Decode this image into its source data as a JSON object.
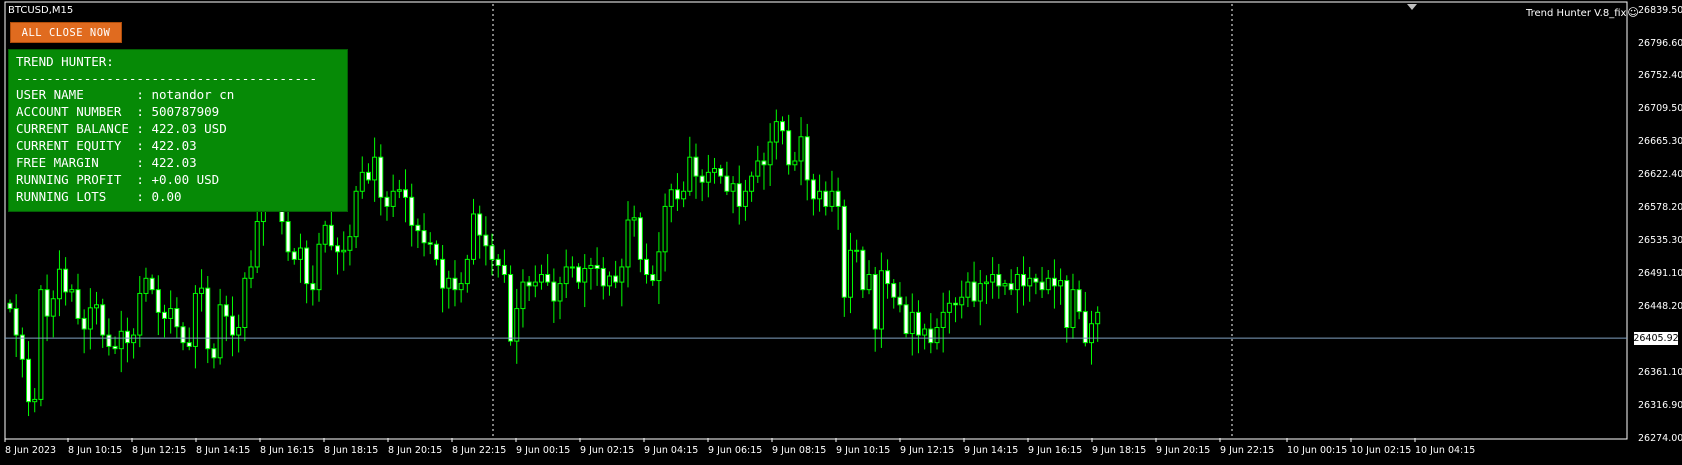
{
  "window": {
    "symbol_label": "BTCUSD,M15",
    "indicator_label": "Trend Hunter V.8_fix",
    "indicator_icon": "smiley-icon"
  },
  "panel": {
    "close_button_label": "ALL CLOSE NOW",
    "title": "TREND HUNTER:",
    "separator": "----------------------------------------",
    "rows": [
      "USER NAME       : notandor cn",
      "ACCOUNT NUMBER  : 500787909",
      "CURRENT BALANCE : 422.03 USD",
      "CURRENT EQUITY  : 422.03",
      "FREE MARGIN     : 422.03",
      "RUNNING PROFIT  : +0.00 USD",
      "RUNNING LOTS    : 0.00"
    ],
    "button_color": "#e06b1f",
    "panel_color": "#068a06"
  },
  "price_axis": {
    "ticks": [
      "26839.50",
      "26796.60",
      "26752.40",
      "26709.50",
      "26665.30",
      "26622.40",
      "26578.20",
      "26535.30",
      "26491.10",
      "26448.20",
      "26405.92",
      "26361.10",
      "26316.90",
      "26274.00"
    ],
    "current_price": "26405.92"
  },
  "time_axis": {
    "labels": [
      "8 Jun 2023",
      "8 Jun 10:15",
      "8 Jun 12:15",
      "8 Jun 14:15",
      "8 Jun 16:15",
      "8 Jun 18:15",
      "8 Jun 20:15",
      "8 Jun 22:15",
      "9 Jun 00:15",
      "9 Jun 02:15",
      "9 Jun 04:15",
      "9 Jun 06:15",
      "9 Jun 08:15",
      "9 Jun 10:15",
      "9 Jun 12:15",
      "9 Jun 14:15",
      "9 Jun 16:15",
      "9 Jun 18:15",
      "9 Jun 20:15",
      "9 Jun 22:15",
      "10 Jun 00:15",
      "10 Jun 02:15",
      "10 Jun 04:15"
    ]
  },
  "chart_data": {
    "type": "candlestick",
    "symbol": "BTCUSD",
    "timeframe": "M15",
    "ylim": [
      26274.0,
      26839.5
    ],
    "current_price": 26405.92,
    "bull_color": "#00ff00",
    "bear_color": "#ffffff",
    "closes": [
      26445,
      26410,
      26378,
      26322,
      26325,
      26470,
      26435,
      26458,
      26497,
      26467,
      26470,
      26432,
      26418,
      26446,
      26450,
      26410,
      26395,
      26392,
      26415,
      26400,
      26410,
      26465,
      26485,
      26470,
      26440,
      26432,
      26445,
      26421,
      26400,
      26395,
      26465,
      26472,
      26392,
      26380,
      26450,
      26435,
      26410,
      26420,
      26485,
      26500,
      26560,
      26600,
      26610,
      26640,
      26560,
      26520,
      26510,
      26525,
      26478,
      26470,
      26530,
      26555,
      26528,
      26520,
      26522,
      26540,
      26600,
      26625,
      26615,
      26645,
      26592,
      26580,
      26600,
      26602,
      26592,
      26555,
      26548,
      26532,
      26530,
      26510,
      26472,
      26485,
      26470,
      26478,
      26510,
      26570,
      26542,
      26528,
      26510,
      26502,
      26490,
      26402,
      26445,
      26480,
      26475,
      26480,
      26490,
      26480,
      26455,
      26478,
      26500,
      26500,
      26480,
      26498,
      26502,
      26498,
      26475,
      26488,
      26480,
      26500,
      26562,
      26565,
      26510,
      26490,
      26482,
      26520,
      26580,
      26602,
      26590,
      26600,
      26645,
      26620,
      26612,
      26625,
      26630,
      26620,
      26600,
      26610,
      26580,
      26600,
      26620,
      26640,
      26635,
      26665,
      26692,
      26680,
      26635,
      26640,
      26672,
      26615,
      26590,
      26600,
      26580,
      26600,
      26580,
      26460,
      26522,
      26522,
      26470,
      26490,
      26418,
      26495,
      26478,
      26460,
      26450,
      26412,
      26440,
      26410,
      26418,
      26400,
      26420,
      26440,
      26452,
      26450,
      26460,
      26480,
      26455,
      26478,
      26480,
      26490,
      26475,
      26478,
      26470,
      26490,
      26475,
      26485,
      26480,
      26470,
      26485,
      26475,
      26482,
      26420,
      26470,
      26441,
      26400,
      26425,
      26440
    ],
    "last_index_at_price": 26405.92
  }
}
